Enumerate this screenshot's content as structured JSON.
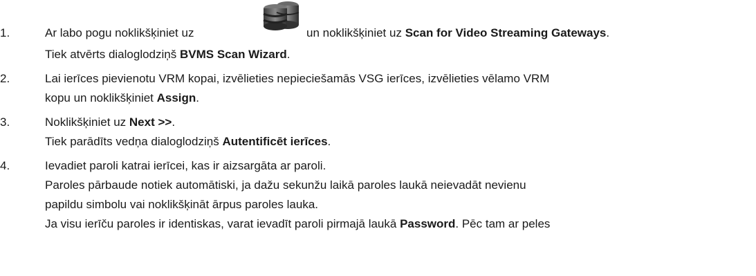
{
  "steps": [
    {
      "number": "1.",
      "lines": [
        {
          "a": "Ar labo pogu noklikšķiniet uz",
          "b": "un noklikšķiniet uz",
          "bold": "Scan for Video Streaming Gateways",
          "c": "."
        },
        {
          "a": "Tiek atvērts dialoglodziņš",
          "bold": "BVMS Scan Wizard",
          "c": "."
        }
      ],
      "icon": "database-server-icon"
    },
    {
      "number": "2.",
      "lines": [
        {
          "a": "Lai ierīces pievienotu VRM kopai, izvēlieties nepieciešamās VSG ierīces, izvēlieties vēlamo VRM"
        },
        {
          "a": "kopu un noklikšķiniet",
          "bold": "Assign",
          "c": "."
        }
      ]
    },
    {
      "number": "3.",
      "lines": [
        {
          "a": "Noklikšķiniet uz",
          "bold": "Next >>",
          "c": "."
        },
        {
          "a": "Tiek parādīts vedņa dialoglodziņš",
          "bold": "Autentificēt ierīces",
          "c": "."
        }
      ]
    },
    {
      "number": "4.",
      "lines": [
        {
          "a": "Ievadiet paroli katrai ierīcei, kas ir aizsargāta ar paroli."
        },
        {
          "a": "Paroles pārbaude notiek automātiski, ja dažu sekunžu laikā paroles laukā neievadāt nevienu"
        },
        {
          "a": "papildu simbolu vai noklikšķināt ārpus paroles lauka."
        },
        {
          "a": "Ja visu ierīču paroles ir identiskas, varat ievadīt paroli pirmajā laukā",
          "bold": "Password",
          "c": ". Pēc tam ar peles"
        }
      ]
    }
  ]
}
